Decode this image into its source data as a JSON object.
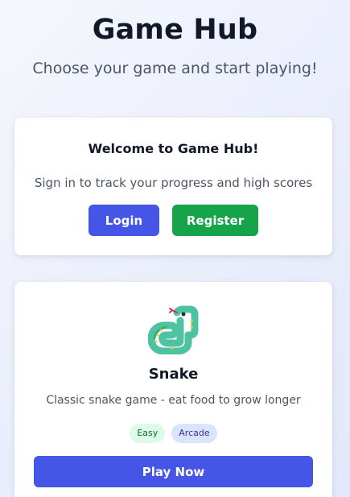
{
  "header": {
    "title": "Game Hub",
    "subtitle": "Choose your game and start playing!"
  },
  "welcome": {
    "title": "Welcome to Game Hub!",
    "text": "Sign in to track your progress and high scores",
    "login_label": "Login",
    "register_label": "Register"
  },
  "games": [
    {
      "icon": "snake-icon",
      "title": "Snake",
      "description": "Classic snake game - eat food to grow longer",
      "badges": [
        "Easy",
        "Arcade"
      ],
      "play_label": "Play Now"
    }
  ],
  "colors": {
    "primary": "#4555e5",
    "success": "#16a34a",
    "badge_easy_bg": "#dcfce7",
    "badge_arcade_bg": "#dbe4fe"
  }
}
